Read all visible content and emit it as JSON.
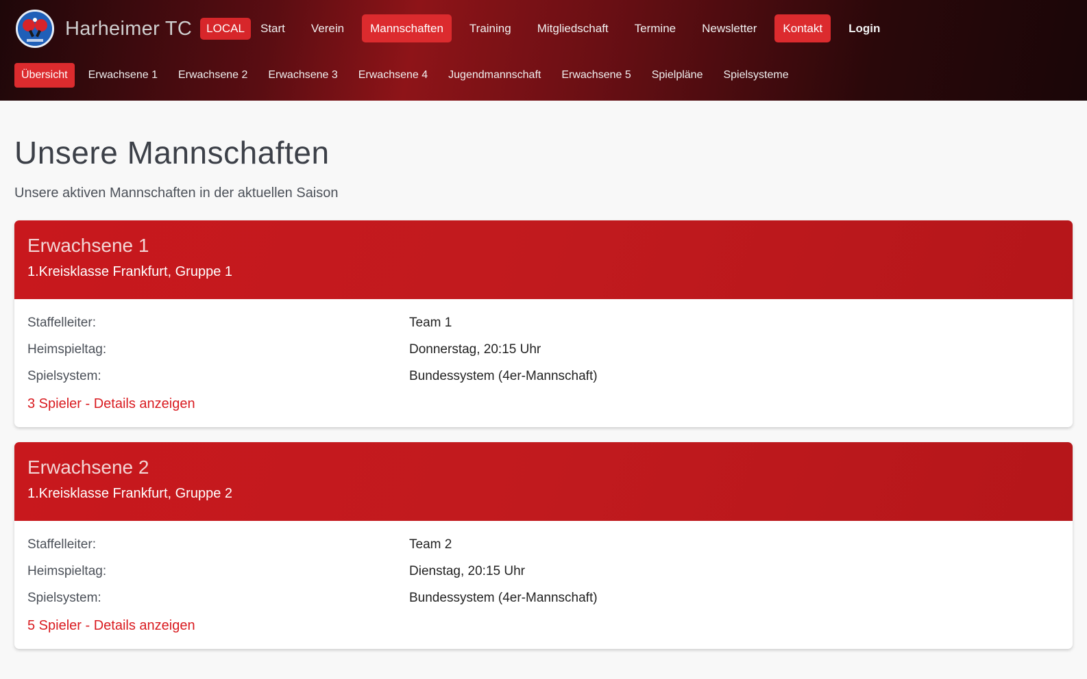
{
  "brand": {
    "name": "Harheimer TC",
    "badge": "LOCAL",
    "logo_icon": "ping-pong-paddles-icon"
  },
  "main_nav": [
    {
      "label": "Start"
    },
    {
      "label": "Verein"
    },
    {
      "label": "Mannschaften",
      "active": true
    },
    {
      "label": "Training"
    },
    {
      "label": "Mitgliedschaft"
    },
    {
      "label": "Termine"
    },
    {
      "label": "Newsletter"
    },
    {
      "label": "Kontakt",
      "highlight": true
    },
    {
      "label": "Login"
    }
  ],
  "sub_nav": [
    {
      "label": "Übersicht",
      "active": true
    },
    {
      "label": "Erwachsene 1"
    },
    {
      "label": "Erwachsene 2"
    },
    {
      "label": "Erwachsene 3"
    },
    {
      "label": "Erwachsene 4"
    },
    {
      "label": "Jugendmannschaft"
    },
    {
      "label": "Erwachsene 5"
    },
    {
      "label": "Spielpläne"
    },
    {
      "label": "Spielsysteme"
    }
  ],
  "page": {
    "title": "Unsere Mannschaften",
    "subtitle": "Unsere aktiven Mannschaften in der aktuellen Saison"
  },
  "teams": [
    {
      "name": "Erwachsene 1",
      "league": "1.Kreisklasse Frankfurt, Gruppe 1",
      "labels": {
        "staffelleiter": "Staffelleiter:",
        "heimspieltag": "Heimspieltag:",
        "spielsystem": "Spielsystem:"
      },
      "staffelleiter": "Team 1",
      "heimspieltag": "Donnerstag, 20:15 Uhr",
      "spielsystem": "Bundessystem (4er-Mannschaft)",
      "details_link": "3 Spieler - Details anzeigen"
    },
    {
      "name": "Erwachsene 2",
      "league": "1.Kreisklasse Frankfurt, Gruppe 2",
      "labels": {
        "staffelleiter": "Staffelleiter:",
        "heimspieltag": "Heimspieltag:",
        "spielsystem": "Spielsystem:"
      },
      "staffelleiter": "Team 2",
      "heimspieltag": "Dienstag, 20:15 Uhr",
      "spielsystem": "Bundessystem (4er-Mannschaft)",
      "details_link": "5 Spieler - Details anzeigen"
    }
  ],
  "colors": {
    "accent": "#dc2b2e",
    "card_header": "#c8181d",
    "link": "#d91a1f"
  }
}
